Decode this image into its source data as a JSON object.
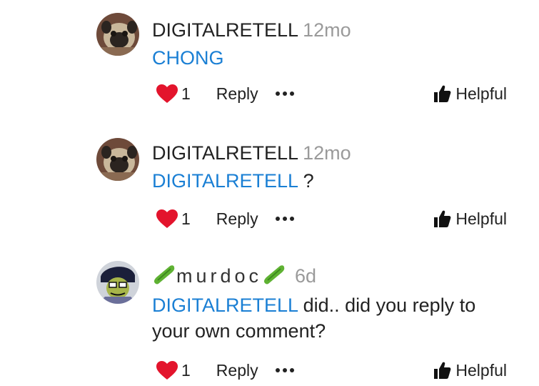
{
  "comments": [
    {
      "username": "DIGITALRETELL",
      "time": "12mo",
      "mention": "CHONG",
      "text": "",
      "avatar": "pug-avatar",
      "likes": "1",
      "reply_label": "Reply",
      "helpful_label": "Helpful"
    },
    {
      "username": "DIGITALRETELL",
      "time": "12mo",
      "mention": "DIGITALRETELL",
      "text": " ?",
      "avatar": "pug-avatar",
      "likes": "1",
      "reply_label": "Reply",
      "helpful_label": "Helpful"
    },
    {
      "username": "murdoc",
      "time": "6d",
      "mention": "DIGITALRETELL",
      "text": " did.. did you reply to your own comment?",
      "avatar": "cartoon-avatar",
      "likes": "1",
      "reply_label": "Reply",
      "helpful_label": "Helpful"
    }
  ],
  "colors": {
    "mention": "#1a7fd4",
    "heart": "#e3142c",
    "timestamp": "#9a9a9a",
    "cucumber": "#5fb233"
  }
}
